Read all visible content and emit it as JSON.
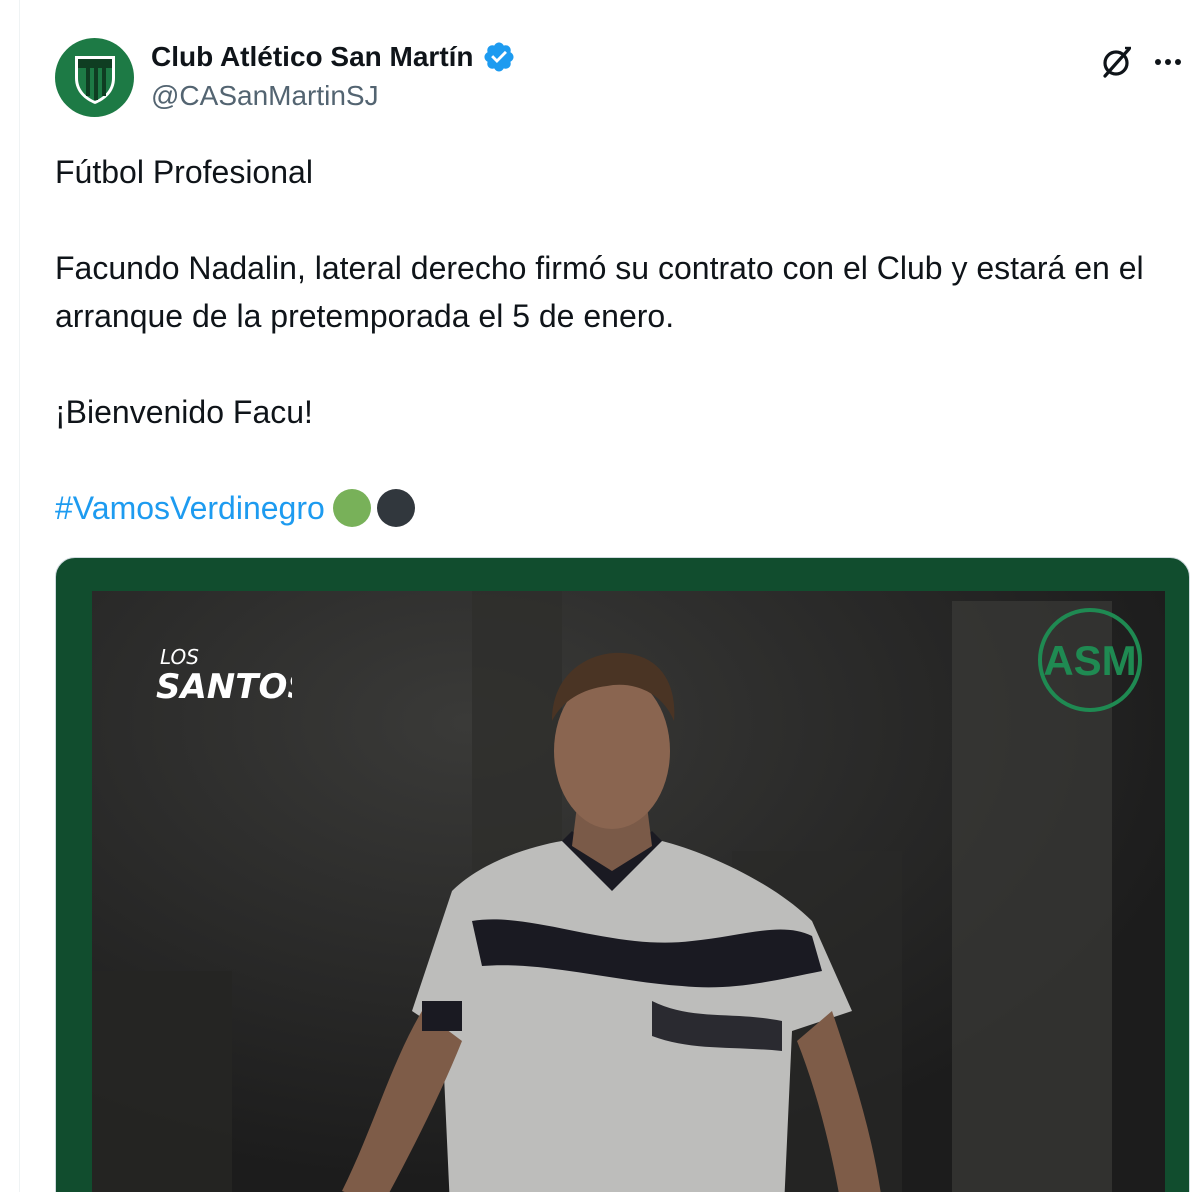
{
  "post": {
    "author": {
      "name": "Club Atlético San Martín",
      "handle": "@CASanMartinSJ",
      "verified": true,
      "avatar_icon": "club-crest-icon"
    },
    "actions": {
      "grok_icon": "grok-slash-icon",
      "more_icon": "more-horizontal-icon"
    },
    "text": {
      "line1": "Fútbol Profesional",
      "paragraph2": "Facundo Nadalin, lateral derecho firmó su contrato con el Club y estará en el arranque de la pretemporada el 5 de enero.",
      "paragraph3": "¡Bienvenido Facu!",
      "hashtag": "#VamosVerdinegro",
      "emojis": [
        "green-circle",
        "black-circle"
      ]
    },
    "media": {
      "type": "photo",
      "description_icons": [
        "los-santos-logo",
        "asm-crest-logo"
      ],
      "logo_text": "LOS SANTOS",
      "crest_text": "ASM"
    }
  },
  "colors": {
    "link": "#1d9bf0",
    "secondary_text": "#536471",
    "verified": "#1d9bf0",
    "club_green": "#1d7a45",
    "frame_green": "#114d2e"
  }
}
